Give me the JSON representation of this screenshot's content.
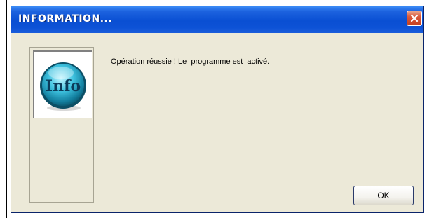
{
  "window": {
    "title": "INFORMATION...",
    "close_icon": "close-icon"
  },
  "content": {
    "image_icon": "info-icon",
    "image_text": "Info",
    "message": "Opération réussie ! Le  programme est  activé."
  },
  "buttons": {
    "ok_label": "OK"
  },
  "colors": {
    "titlebar": "#0a4fd3",
    "dialog_bg": "#ece9d8",
    "close_button": "#d9573b",
    "info_circle": "#1aa0c0"
  }
}
